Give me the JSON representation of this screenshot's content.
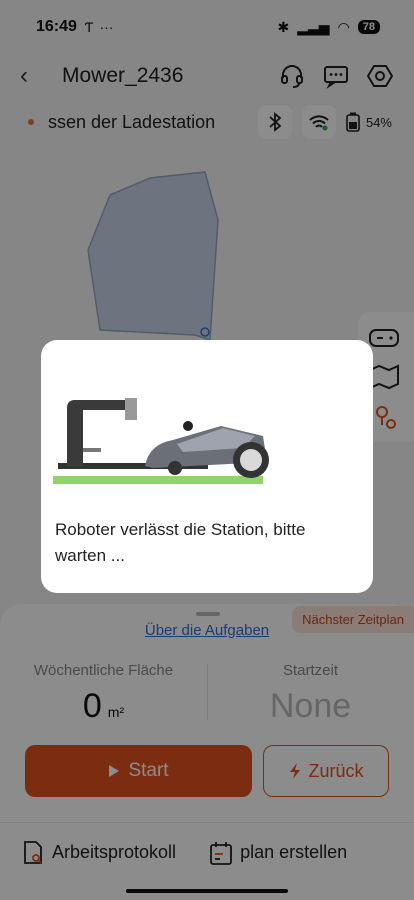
{
  "status_bar": {
    "time": "16:49",
    "left_icons": [
      "T-icon",
      "more-dots-icon"
    ],
    "battery": "78"
  },
  "header": {
    "back_label": "‹",
    "title": "Mower_2436"
  },
  "status_row": {
    "text": "ssen der Ladestation",
    "battery_percent": "54%"
  },
  "modal": {
    "message": "Roboter verlässt die Station, bitte warten ..."
  },
  "panel": {
    "tasks_link": "Über die Aufgaben",
    "next_schedule": "Nächster Zeitplan",
    "weekly_area_label": "Wöchentliche Fläche",
    "weekly_area_value": "0",
    "weekly_area_unit": "m²",
    "start_time_label": "Startzeit",
    "start_time_value": "None",
    "start_button": "Start",
    "back_button": "Zurück"
  },
  "bottom_bar": {
    "log": "Arbeitsprotokoll",
    "plan": "plan erstellen"
  },
  "colors": {
    "accent": "#e2521f",
    "link": "#2f6fd6",
    "status_dot": "#e07b32"
  }
}
